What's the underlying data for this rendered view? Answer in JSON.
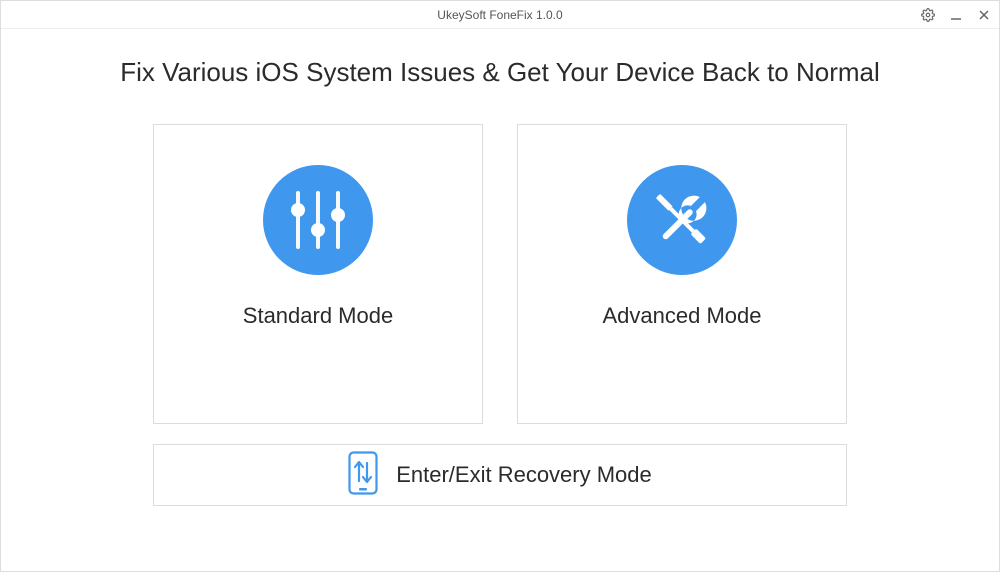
{
  "app": {
    "title": "UkeySoft FoneFix 1.0.0"
  },
  "headline": "Fix Various iOS System Issues & Get Your Device Back to Normal",
  "modes": {
    "standard": {
      "label": "Standard Mode"
    },
    "advanced": {
      "label": "Advanced Mode"
    }
  },
  "recovery": {
    "label": "Enter/Exit Recovery Mode"
  },
  "colors": {
    "accent": "#3f97ee"
  }
}
